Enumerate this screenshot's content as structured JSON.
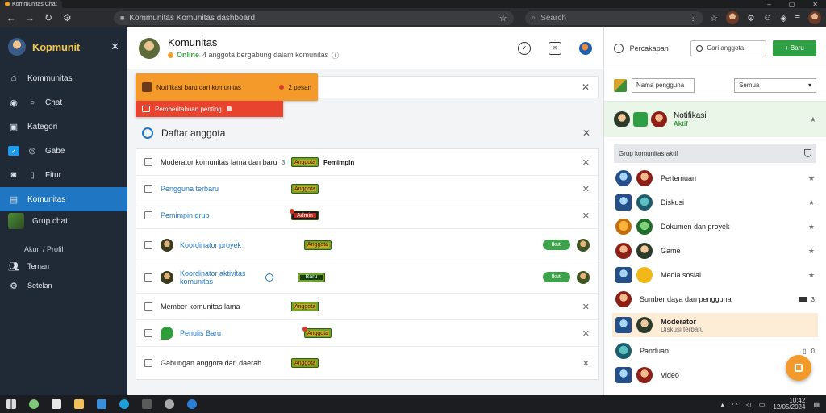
{
  "browser": {
    "tab_title": "Kommunitas Chat",
    "url": "Kommunitas Komunitas dashboard",
    "search_placeholder": "Search"
  },
  "sidebar": {
    "brand": "Kopmunit",
    "items": [
      {
        "label": "Kommunitas"
      },
      {
        "label": "Chat"
      },
      {
        "label": "Kategori"
      },
      {
        "label": "Gabe"
      },
      {
        "label": "Fitur"
      },
      {
        "label": "Komunitas"
      },
      {
        "label": "Grup chat"
      }
    ],
    "section_label": "Akun / Profil",
    "section_items": [
      {
        "label": "Teman"
      },
      {
        "label": "Setelan"
      }
    ]
  },
  "center": {
    "title": "Komunitas",
    "subtitle_tag": "Online",
    "subtitle": "4 anggota bergabung dalam komunitas",
    "toast_primary": "Notifikasi baru dari komunitas",
    "toast_count": "2 pesan",
    "toast_secondary": "Pemberitahuan penting",
    "search_label": "Daftar anggota",
    "rows": [
      {
        "name": "Moderator komunitas lama dan baru",
        "meta": "3",
        "badge": "Anggota",
        "extra": "Pemimpin",
        "style": "dark"
      },
      {
        "name": "Pengguna terbaru",
        "badge": "Anggota",
        "style": "blue"
      },
      {
        "name": "Pemimpin grup",
        "badge": "Admin",
        "style": "blue"
      },
      {
        "name": "Koordinator proyek",
        "badge": "Anggota",
        "style": "blue",
        "action": "Ikuti"
      },
      {
        "name": "Koordinator aktivitas komunitas",
        "badge": "Baru",
        "style": "blue",
        "action": "Ikuti"
      },
      {
        "name": "Member komunitas lama",
        "badge": "Anggota",
        "style": "dark"
      },
      {
        "name": "Penulis Baru",
        "badge": "Anggota",
        "style": "blue"
      },
      {
        "name": "Gabungan anggota dari daerah",
        "badge": "Anggota",
        "style": "dark"
      }
    ]
  },
  "right": {
    "top_label": "Percakapan",
    "search_placeholder": "Cari anggota",
    "new_button": "+ Baru",
    "filter_input": "Nama pengguna",
    "filter_select": "Semua",
    "highlight_title": "Notifikasi",
    "highlight_status": "Aktif",
    "group_label": "Grup komunitas aktif",
    "items": [
      {
        "name": "Pertemuan"
      },
      {
        "name": "Diskusi"
      },
      {
        "name": "Dokumen dan proyek"
      },
      {
        "name": "Game"
      },
      {
        "name": "Media sosial"
      },
      {
        "name": "Sumber daya dan pengguna",
        "count": "3"
      },
      {
        "name": "Moderator",
        "sub": "Diskusi terbaru",
        "highlight": true
      },
      {
        "name": "Panduan",
        "count": "0"
      },
      {
        "name": "Video"
      }
    ]
  },
  "taskbar": {
    "time": "10:42",
    "date": "12/05/2024"
  },
  "colors": {
    "accent": "#1f77c4",
    "sidebar_bg": "#1f2a36",
    "toast_orange": "#f39a2b",
    "toast_red": "#e7432e",
    "success": "#2ea043"
  }
}
